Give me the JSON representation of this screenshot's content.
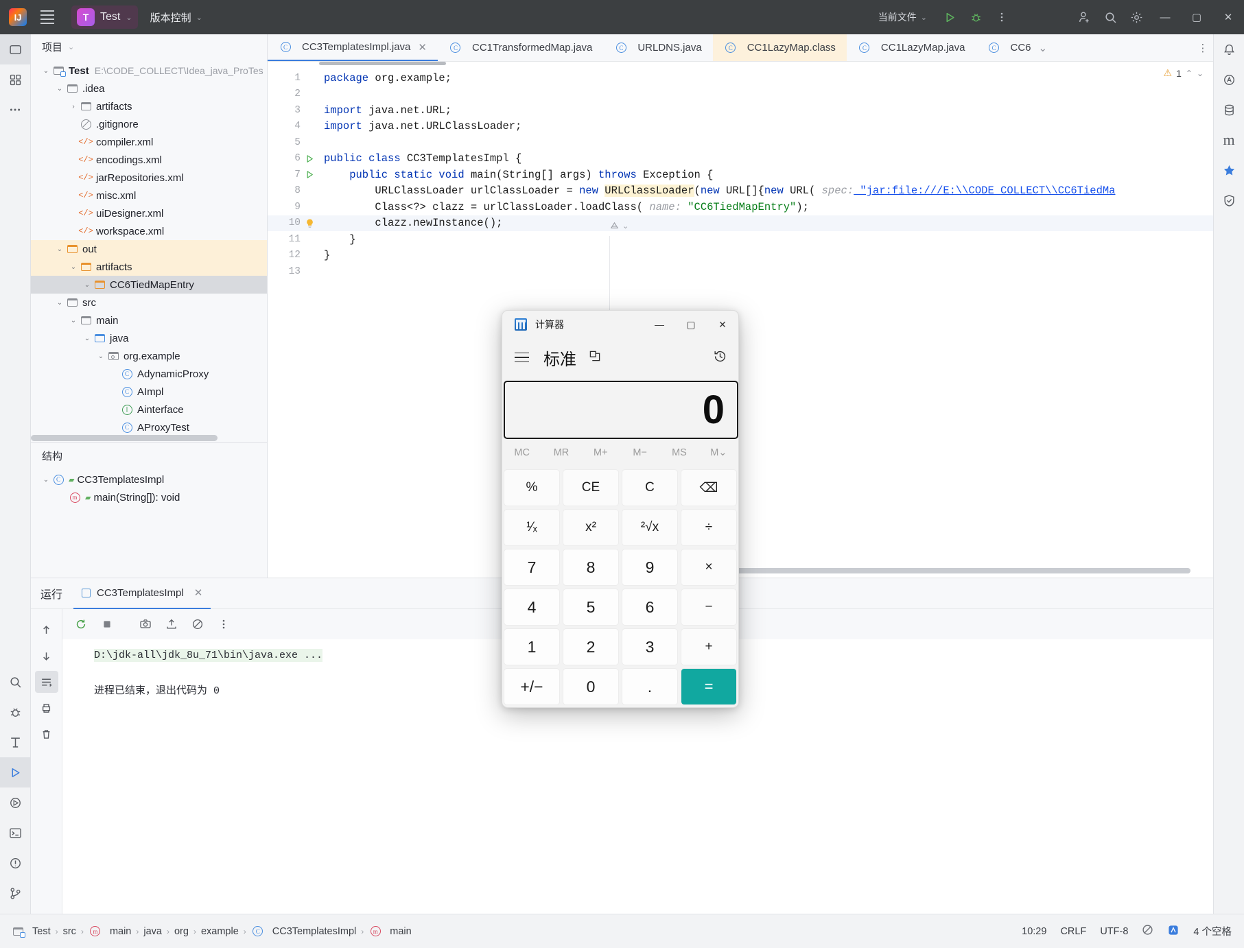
{
  "titlebar": {
    "project_name": "Test",
    "project_badge": "T",
    "vcs_label": "版本控制",
    "run_config": "当前文件",
    "icons": [
      "run-icon",
      "debug-icon",
      "more-actions-icon",
      "add-user-icon",
      "search-icon",
      "settings-icon"
    ],
    "window_min": "—",
    "window_max": "▢",
    "window_close": "✕"
  },
  "project_panel": {
    "header": "项目",
    "tree": [
      {
        "indent": 0,
        "arrow": "v",
        "icon": "module-icon",
        "label": "Test",
        "bold": true,
        "path": "E:\\CODE_COLLECT\\Idea_java_ProTes",
        "state": ""
      },
      {
        "indent": 1,
        "arrow": "v",
        "icon": "folder-icon",
        "label": ".idea",
        "bold": false,
        "path": "",
        "state": ""
      },
      {
        "indent": 2,
        "arrow": ">",
        "icon": "folder-icon",
        "label": "artifacts",
        "bold": false,
        "path": "",
        "state": ""
      },
      {
        "indent": 2,
        "arrow": "",
        "icon": "gitignore-icon",
        "label": ".gitignore",
        "bold": false,
        "path": "",
        "state": ""
      },
      {
        "indent": 2,
        "arrow": "",
        "icon": "xml-icon",
        "label": "compiler.xml",
        "bold": false,
        "path": "",
        "state": ""
      },
      {
        "indent": 2,
        "arrow": "",
        "icon": "xml-icon",
        "label": "encodings.xml",
        "bold": false,
        "path": "",
        "state": ""
      },
      {
        "indent": 2,
        "arrow": "",
        "icon": "xml-icon",
        "label": "jarRepositories.xml",
        "bold": false,
        "path": "",
        "state": ""
      },
      {
        "indent": 2,
        "arrow": "",
        "icon": "xml-icon",
        "label": "misc.xml",
        "bold": false,
        "path": "",
        "state": ""
      },
      {
        "indent": 2,
        "arrow": "",
        "icon": "xml-icon",
        "label": "uiDesigner.xml",
        "bold": false,
        "path": "",
        "state": ""
      },
      {
        "indent": 2,
        "arrow": "",
        "icon": "xml-icon",
        "label": "workspace.xml",
        "bold": false,
        "path": "",
        "state": ""
      },
      {
        "indent": 1,
        "arrow": "v",
        "icon": "folder-orange-icon",
        "label": "out",
        "bold": false,
        "path": "",
        "state": "hl-out"
      },
      {
        "indent": 2,
        "arrow": "v",
        "icon": "folder-orange-icon",
        "label": "artifacts",
        "bold": false,
        "path": "",
        "state": "hl-out"
      },
      {
        "indent": 3,
        "arrow": "v",
        "icon": "folder-orange-icon",
        "label": "CC6TiedMapEntry",
        "bold": false,
        "path": "",
        "state": "sel"
      },
      {
        "indent": 1,
        "arrow": "v",
        "icon": "folder-icon",
        "label": "src",
        "bold": false,
        "path": "",
        "state": ""
      },
      {
        "indent": 2,
        "arrow": "v",
        "icon": "folder-icon",
        "label": "main",
        "bold": false,
        "path": "",
        "state": ""
      },
      {
        "indent": 3,
        "arrow": "v",
        "icon": "folder-blue-icon",
        "label": "java",
        "bold": false,
        "path": "",
        "state": ""
      },
      {
        "indent": 4,
        "arrow": "v",
        "icon": "package-icon",
        "label": "org.example",
        "bold": false,
        "path": "",
        "state": ""
      },
      {
        "indent": 5,
        "arrow": "",
        "icon": "class-icon",
        "label": "AdynamicProxy",
        "bold": false,
        "path": "",
        "state": ""
      },
      {
        "indent": 5,
        "arrow": "",
        "icon": "class-icon",
        "label": "AImpl",
        "bold": false,
        "path": "",
        "state": ""
      },
      {
        "indent": 5,
        "arrow": "",
        "icon": "interface-icon",
        "label": "Ainterface",
        "bold": false,
        "path": "",
        "state": ""
      },
      {
        "indent": 5,
        "arrow": "",
        "icon": "class-icon",
        "label": "AProxyTest",
        "bold": false,
        "path": "",
        "state": ""
      }
    ]
  },
  "structure_panel": {
    "header": "结构",
    "items": [
      {
        "indent": 0,
        "arrow": "v",
        "icon": "class-icon",
        "label": "CC3TemplatesImpl"
      },
      {
        "indent": 1,
        "arrow": "",
        "icon": "method-icon",
        "label": "main(String[]): void"
      }
    ]
  },
  "editor_tabs": [
    {
      "label": "CC3TemplatesImpl.java",
      "icon": "class-icon",
      "active": true,
      "closable": true,
      "highlight": false
    },
    {
      "label": "CC1TransformedMap.java",
      "icon": "class-icon",
      "active": false,
      "closable": false,
      "highlight": false
    },
    {
      "label": "URLDNS.java",
      "icon": "class-icon",
      "active": false,
      "closable": false,
      "highlight": false
    },
    {
      "label": "CC1LazyMap.class",
      "icon": "class-icon",
      "active": false,
      "closable": false,
      "highlight": true
    },
    {
      "label": "CC1LazyMap.java",
      "icon": "class-icon",
      "active": false,
      "closable": false,
      "highlight": false
    },
    {
      "label": "CC6",
      "icon": "class-icon",
      "active": false,
      "closable": false,
      "highlight": false
    }
  ],
  "editor": {
    "warning_count": "1",
    "inlay_hint": "annotation-inlay",
    "lines": [
      {
        "no": "1",
        "gutter": "",
        "current": false,
        "tokens": [
          {
            "t": "package ",
            "c": "kw"
          },
          {
            "t": "org.example;",
            "c": ""
          }
        ]
      },
      {
        "no": "2",
        "gutter": "",
        "current": false,
        "tokens": []
      },
      {
        "no": "3",
        "gutter": "",
        "current": false,
        "tokens": [
          {
            "t": "import ",
            "c": "kw"
          },
          {
            "t": "java.net.URL;",
            "c": ""
          }
        ]
      },
      {
        "no": "4",
        "gutter": "",
        "current": false,
        "tokens": [
          {
            "t": "import ",
            "c": "kw"
          },
          {
            "t": "java.net.URLClassLoader;",
            "c": ""
          }
        ]
      },
      {
        "no": "5",
        "gutter": "",
        "current": false,
        "tokens": []
      },
      {
        "no": "6",
        "gutter": "run",
        "current": false,
        "tokens": [
          {
            "t": "public class ",
            "c": "kw"
          },
          {
            "t": "CC3TemplatesImpl {",
            "c": ""
          }
        ]
      },
      {
        "no": "7",
        "gutter": "run",
        "current": false,
        "tokens": [
          {
            "t": "    public static void ",
            "c": "kw"
          },
          {
            "t": "main",
            "c": "fn"
          },
          {
            "t": "(String[] args) ",
            "c": ""
          },
          {
            "t": "throws ",
            "c": "kw"
          },
          {
            "t": "Exception {",
            "c": ""
          }
        ]
      },
      {
        "no": "8",
        "gutter": "",
        "current": false,
        "tokens": [
          {
            "t": "        URLClassLoader urlClassLoader = ",
            "c": ""
          },
          {
            "t": "new ",
            "c": "kw"
          },
          {
            "t": "URLClassLoader",
            "c": "hl"
          },
          {
            "t": "(",
            "c": ""
          },
          {
            "t": "new ",
            "c": "kw"
          },
          {
            "t": "URL[]{",
            "c": ""
          },
          {
            "t": "new ",
            "c": "kw"
          },
          {
            "t": "URL( ",
            "c": ""
          },
          {
            "t": "spec:",
            "c": "hint"
          },
          {
            "t": " \"jar:file:///E:\\\\CODE_COLLECT\\\\CC6TiedMa",
            "c": "urlstr"
          }
        ]
      },
      {
        "no": "9",
        "gutter": "",
        "current": false,
        "tokens": [
          {
            "t": "        Class<?> clazz = urlClassLoader.loadClass( ",
            "c": ""
          },
          {
            "t": "name:",
            "c": "hint"
          },
          {
            "t": " ",
            "c": ""
          },
          {
            "t": "\"CC6TiedMapEntry\"",
            "c": "str"
          },
          {
            "t": ");",
            "c": ""
          }
        ]
      },
      {
        "no": "10",
        "gutter": "bulb",
        "current": true,
        "tokens": [
          {
            "t": "        clazz.newInstance();",
            "c": ""
          }
        ]
      },
      {
        "no": "11",
        "gutter": "",
        "current": false,
        "tokens": [
          {
            "t": "    }",
            "c": ""
          }
        ]
      },
      {
        "no": "12",
        "gutter": "",
        "current": false,
        "tokens": [
          {
            "t": "}",
            "c": ""
          }
        ]
      },
      {
        "no": "13",
        "gutter": "",
        "current": false,
        "tokens": []
      }
    ]
  },
  "run_panel": {
    "title": "运行",
    "tab_label": "CC3TemplatesImpl",
    "tab_closable": true,
    "console": {
      "command_line": "D:\\jdk-all\\jdk_8u_71\\bin\\java.exe ...",
      "result_line": "进程已结束，退出代码为 0"
    },
    "toolbar_icons": [
      "rerun-icon",
      "stop-icon",
      "camera-icon",
      "export-icon",
      "clear-icon",
      "more-icon"
    ],
    "side_icons": [
      "scroll-up-icon",
      "scroll-down-icon",
      "soft-wrap-icon",
      "print-icon",
      "trash-icon"
    ]
  },
  "status_bar": {
    "breadcrumbs": [
      "Test",
      "src",
      "main",
      "java",
      "org",
      "example",
      "CC3TemplatesImpl",
      "main"
    ],
    "right_items": [
      "10:29",
      "CRLF",
      "UTF-8",
      "4 个空格"
    ],
    "right_icons": [
      "no-access-icon",
      "plugin-icon"
    ]
  },
  "calculator": {
    "window_title": "计算器",
    "mode": "标准",
    "display_value": "0",
    "memory_row": [
      "MC",
      "MR",
      "M+",
      "M−",
      "MS",
      "M⌄"
    ],
    "window_controls": [
      "—",
      "▢",
      "✕"
    ],
    "keys": [
      [
        {
          "label": "%",
          "type": "fn"
        },
        {
          "label": "CE",
          "type": "fn"
        },
        {
          "label": "C",
          "type": "fn"
        },
        {
          "label": "⌫",
          "type": "fn"
        }
      ],
      [
        {
          "label": "¹⁄ₓ",
          "type": "fn"
        },
        {
          "label": "x²",
          "type": "fn"
        },
        {
          "label": "²√x",
          "type": "fn"
        },
        {
          "label": "÷",
          "type": "fn"
        }
      ],
      [
        {
          "label": "7",
          "type": "num"
        },
        {
          "label": "8",
          "type": "num"
        },
        {
          "label": "9",
          "type": "num"
        },
        {
          "label": "×",
          "type": "fn"
        }
      ],
      [
        {
          "label": "4",
          "type": "num"
        },
        {
          "label": "5",
          "type": "num"
        },
        {
          "label": "6",
          "type": "num"
        },
        {
          "label": "−",
          "type": "fn"
        }
      ],
      [
        {
          "label": "1",
          "type": "num"
        },
        {
          "label": "2",
          "type": "num"
        },
        {
          "label": "3",
          "type": "num"
        },
        {
          "label": "+",
          "type": "fn"
        }
      ],
      [
        {
          "label": "+/−",
          "type": "num"
        },
        {
          "label": "0",
          "type": "num"
        },
        {
          "label": ".",
          "type": "num"
        },
        {
          "label": "=",
          "type": "eq"
        }
      ]
    ]
  },
  "colors": {
    "titlebar_bg": "#3c3f41",
    "accent_blue": "#3b7ddd",
    "calc_equals": "#11a8a0",
    "highlight_yellow": "#fdf1dc",
    "keyword": "#0033b3",
    "string": "#067d17"
  }
}
